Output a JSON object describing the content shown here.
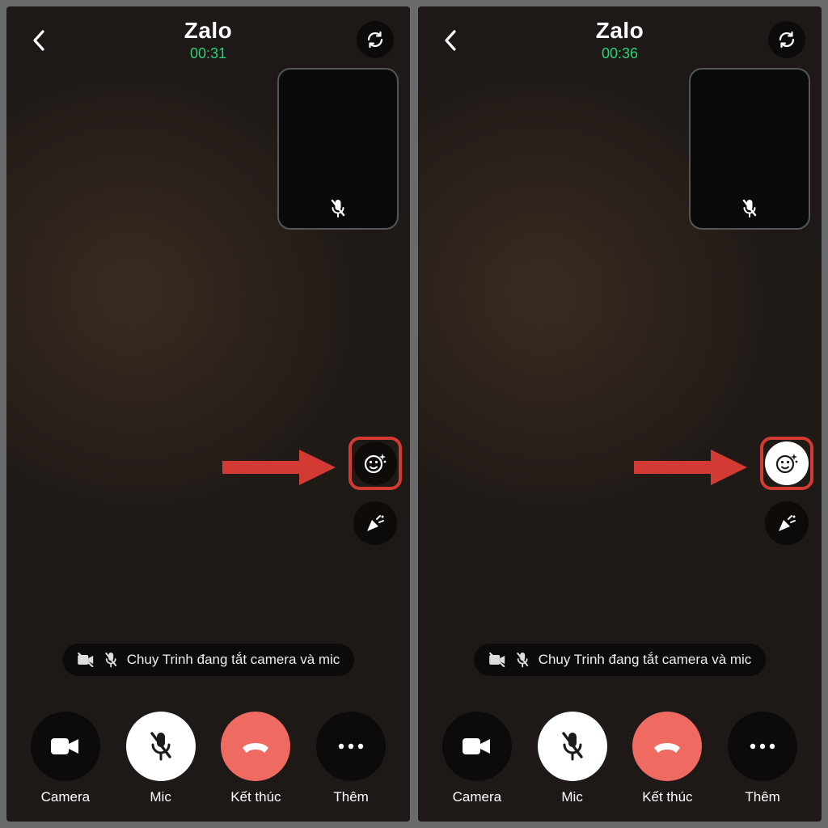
{
  "screens": [
    {
      "title": "Zalo",
      "timer": "00:31",
      "effects_active": false,
      "status_text": "Chuy Trinh đang tắt camera và mic",
      "controls": [
        {
          "label": "Camera"
        },
        {
          "label": "Mic"
        },
        {
          "label": "Kết thúc"
        },
        {
          "label": "Thêm"
        }
      ]
    },
    {
      "title": "Zalo",
      "timer": "00:36",
      "effects_active": true,
      "status_text": "Chuy Trinh đang tắt camera và mic",
      "controls": [
        {
          "label": "Camera"
        },
        {
          "label": "Mic"
        },
        {
          "label": "Kết thúc"
        },
        {
          "label": "Thêm"
        }
      ]
    }
  ],
  "icons": {
    "back": "back-icon",
    "flip": "flip-camera-icon",
    "mic_muted": "mic-muted-icon",
    "effects": "sparkle-face-icon",
    "party": "party-popper-icon",
    "camera_off": "camera-off-icon",
    "camera": "videocam-icon",
    "end": "end-call-icon",
    "more": "more-icon"
  }
}
